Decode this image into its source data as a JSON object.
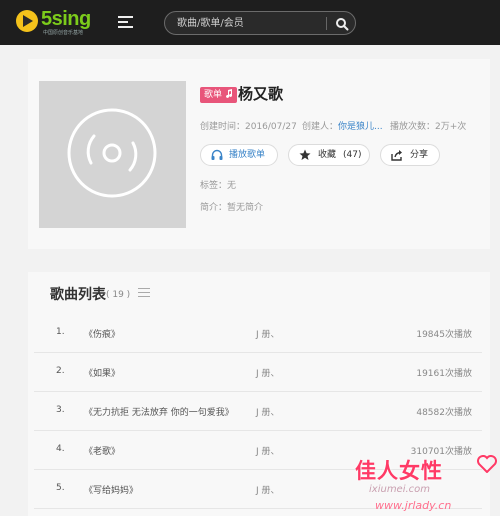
{
  "header": {
    "logo_text": "5sing",
    "logo_subtitle": "中国原创音乐基地",
    "search_placeholder": "歌曲/歌单/会员"
  },
  "album": {
    "tag": "歌单",
    "title": "杨又歌",
    "created_time": "创建时间：2016/07/27",
    "creator_label": "创建人：",
    "creator_name": "你是狼儿...",
    "play_count": "播放次数：2万+次",
    "play_button": "播放歌单",
    "collect_button": "收藏",
    "collect_count": "(47)",
    "share_button": "分享",
    "tags": "标签：无",
    "intro": "简介：暂无简介"
  },
  "song_list": {
    "title": "歌曲列表",
    "count": "( 19 )",
    "songs": [
      {
        "num": "1.",
        "name": "《伤痕》",
        "singer": "J 册、",
        "plays": "19845次播放"
      },
      {
        "num": "2.",
        "name": "《如果》",
        "singer": "J 册、",
        "plays": "19161次播放"
      },
      {
        "num": "3.",
        "name": "《无力抗拒 无法放弃 你的一句爱我》",
        "singer": "J 册、",
        "plays": "48582次播放"
      },
      {
        "num": "4.",
        "name": "《老歌》",
        "singer": "J 册、",
        "plays": "310701次播放"
      },
      {
        "num": "5.",
        "name": "《写给妈妈》",
        "singer": "J 册、",
        "plays": ""
      }
    ]
  },
  "watermark": {
    "main": "佳人女性",
    "sub": "ixiumei.com",
    "url": "www.jrlady.cn"
  },
  "colors": {
    "header_bg": "#1e1e1e",
    "logo_green": "#7ccb1b",
    "tag_pink": "#e8557a",
    "link_blue": "#3a84c8",
    "watermark_pink": "#ff3a66"
  }
}
